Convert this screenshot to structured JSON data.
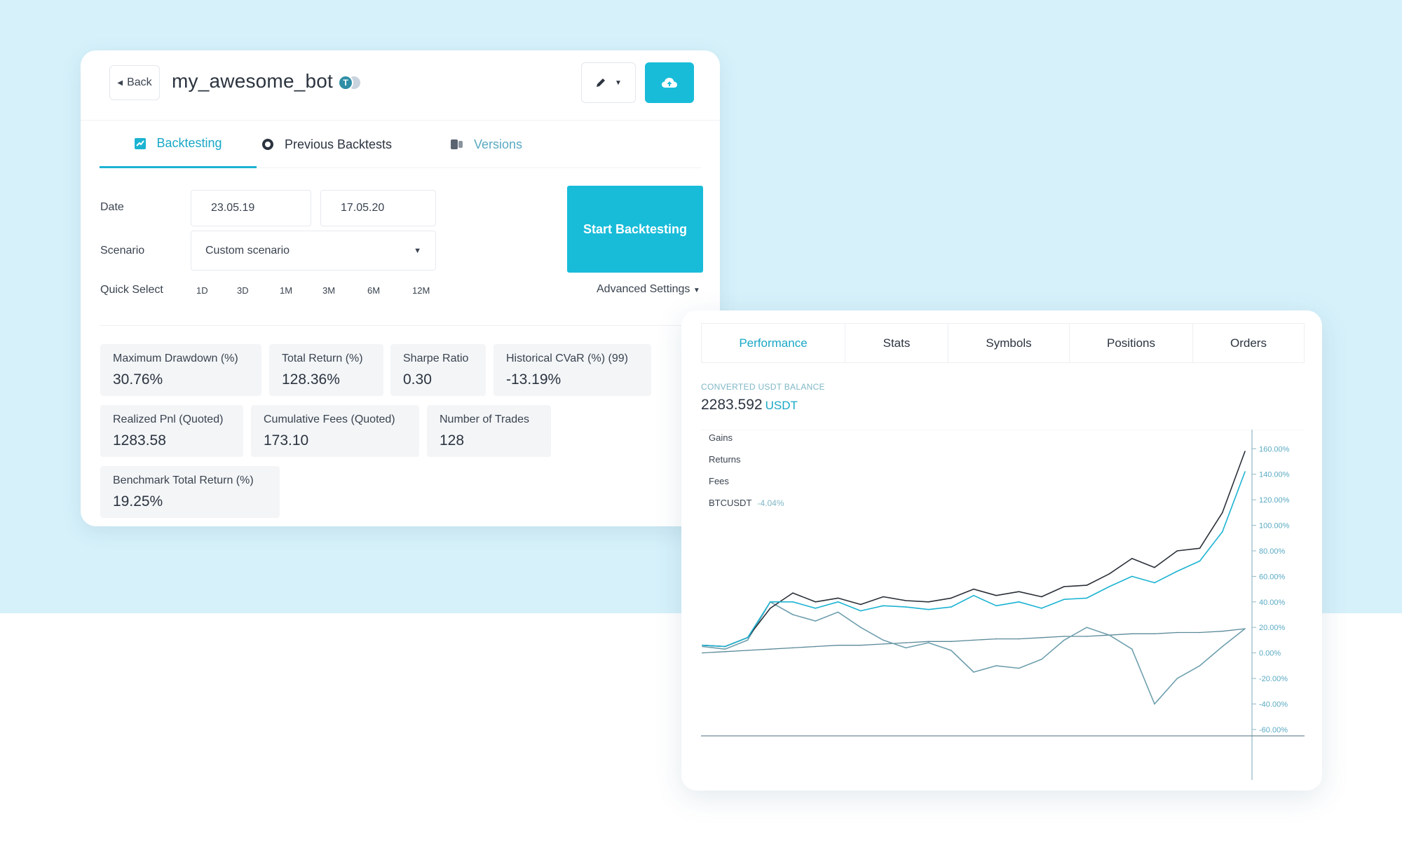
{
  "header": {
    "back_label": "Back",
    "bot_name": "my_awesome_bot",
    "badge_letter": "T"
  },
  "tabs": [
    {
      "label": "Backtesting",
      "active": true,
      "icon": "chart-icon"
    },
    {
      "label": "Previous Backtests",
      "active": false,
      "icon": "history-icon"
    },
    {
      "label": "Versions",
      "active": false,
      "icon": "versions-icon"
    }
  ],
  "form": {
    "date_label": "Date",
    "date_from": "23.05.19",
    "date_to": "17.05.20",
    "scenario_label": "Scenario",
    "scenario_value": "Custom scenario",
    "quick_select_label": "Quick Select",
    "quick_select_options": [
      "1D",
      "3D",
      "1M",
      "3M",
      "6M",
      "12M"
    ],
    "start_button": "Start Backtesting",
    "advanced_settings": "Advanced Settings"
  },
  "stats": {
    "max_drawdown": {
      "label": "Maximum Drawdown (%)",
      "value": "30.76%"
    },
    "total_return": {
      "label": "Total Return (%)",
      "value": "128.36%"
    },
    "sharpe": {
      "label": "Sharpe Ratio",
      "value": "0.30"
    },
    "cvar": {
      "label": "Historical CVaR (%) (99)",
      "value": "-13.19%"
    },
    "realized_pnl": {
      "label": "Realized Pnl (Quoted)",
      "value": "1283.58"
    },
    "cum_fees": {
      "label": "Cumulative Fees (Quoted)",
      "value": "173.10"
    },
    "num_trades": {
      "label": "Number of Trades",
      "value": "128"
    },
    "benchmark": {
      "label": "Benchmark Total Return (%)",
      "value": "19.25%"
    }
  },
  "performance": {
    "tabs": [
      "Performance",
      "Stats",
      "Symbols",
      "Positions",
      "Orders"
    ],
    "active_tab": "Performance",
    "balance_label": "CONVERTED USDT BALANCE",
    "balance_value": "2283.592",
    "balance_unit": "USDT"
  },
  "colors": {
    "accent": "#18bcd9",
    "gains": "#2a3038",
    "returns": "#1cb3d2",
    "fees": "#5b8a99",
    "benchmark": "#6f9fae"
  },
  "chart_data": {
    "type": "line",
    "legend": [
      {
        "name": "Gains",
        "value": ""
      },
      {
        "name": "Returns",
        "value": ""
      },
      {
        "name": "Fees",
        "value": ""
      },
      {
        "name": "BTCUSDT",
        "value": "-4.04%"
      }
    ],
    "y_ticks": [
      "160.00%",
      "140.00%",
      "120.00%",
      "100.00%",
      "80.00%",
      "60.00%",
      "40.00%",
      "20.00%",
      "0.00%",
      "-20.00%",
      "-40.00%",
      "-60.00%"
    ],
    "ylim": [
      -65,
      175
    ],
    "x": [
      0,
      15,
      30,
      45,
      60,
      75,
      90,
      105,
      120,
      135,
      150,
      165,
      180,
      195,
      210,
      225,
      240,
      255,
      270,
      285,
      300,
      315,
      330,
      345,
      360
    ],
    "series": [
      {
        "name": "Gains",
        "values": [
          6,
          5,
          12,
          35,
          47,
          40,
          43,
          38,
          44,
          41,
          40,
          43,
          50,
          45,
          48,
          44,
          52,
          53,
          62,
          74,
          67,
          80,
          82,
          110,
          158
        ]
      },
      {
        "name": "Returns",
        "values": [
          6,
          5,
          12,
          40,
          40,
          35,
          40,
          33,
          37,
          36,
          34,
          36,
          45,
          37,
          40,
          35,
          42,
          43,
          52,
          60,
          55,
          64,
          72,
          95,
          142
        ]
      },
      {
        "name": "Fees",
        "values": [
          0,
          1,
          2,
          3,
          4,
          5,
          6,
          6,
          7,
          8,
          9,
          9,
          10,
          11,
          11,
          12,
          13,
          13,
          14,
          15,
          15,
          16,
          16,
          17,
          19
        ]
      },
      {
        "name": "BTCUSDT",
        "values": [
          5,
          3,
          10,
          40,
          30,
          25,
          32,
          20,
          10,
          4,
          8,
          2,
          -15,
          -10,
          -12,
          -5,
          10,
          20,
          14,
          3,
          -40,
          -20,
          -10,
          5,
          19
        ]
      }
    ]
  }
}
